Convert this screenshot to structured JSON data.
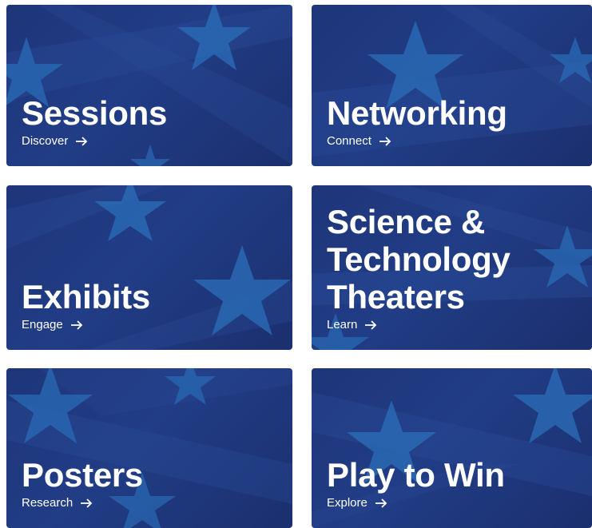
{
  "cards": [
    {
      "title": "Sessions",
      "link": "Discover"
    },
    {
      "title": "Networking",
      "link": "Connect"
    },
    {
      "title": "Exhibits",
      "link": "Engage"
    },
    {
      "title": "Science & Technology Theaters",
      "link": "Learn"
    },
    {
      "title": "Posters",
      "link": "Research"
    },
    {
      "title": "Play to Win",
      "link": "Explore"
    }
  ],
  "colors": {
    "card_background": "#1e3579",
    "star": "#2a6bb5",
    "stripe": "#2b4e9b",
    "text": "#ffffff"
  },
  "icons": {
    "link_arrow": "arrow-right-icon",
    "decoration": "star-icon"
  }
}
